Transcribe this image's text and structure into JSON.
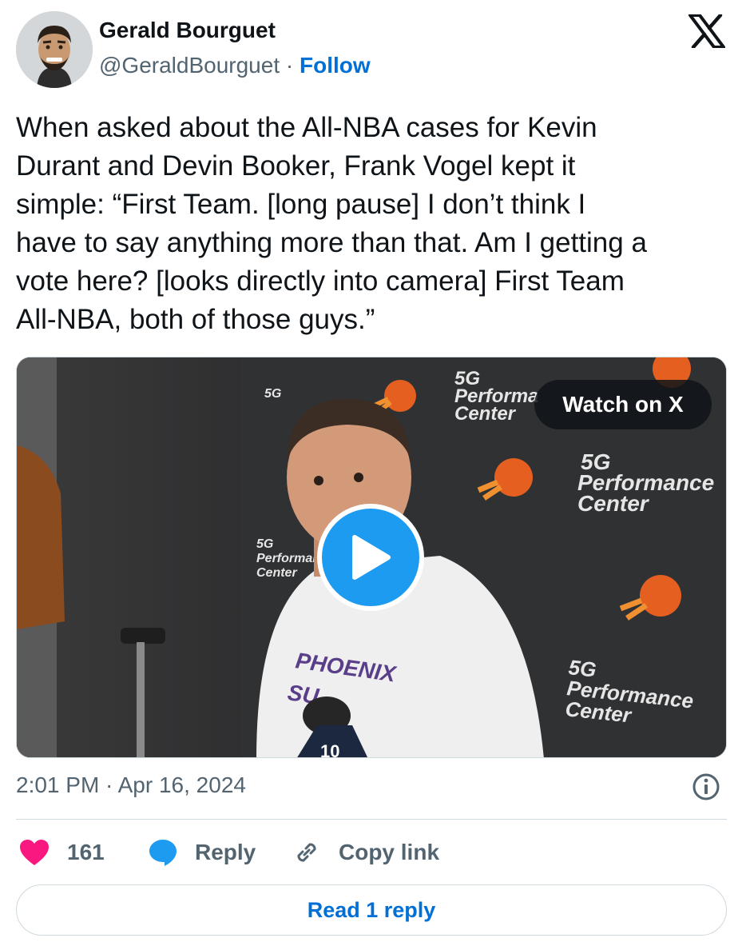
{
  "author": {
    "name": "Gerald Bourguet",
    "handle": "@GeraldBourguet",
    "separator": "·",
    "follow_label": "Follow"
  },
  "tweet": {
    "text": "When asked about the All-NBA cases for Kevin\nDurant and Devin Booker, Frank Vogel kept it\nsimple: “First Team. [long pause] I don’t think I\nhave to say anything more than that. Am I getting a\nvote here? [looks directly into camera] First Team\nAll-NBA, both of those guys.”"
  },
  "media": {
    "watch_label": "Watch on X",
    "backdrop_text": [
      "5G",
      "Performance",
      "Center"
    ],
    "shirt_text": [
      "PHOENIX",
      "SU"
    ],
    "mic_text": "10"
  },
  "meta": {
    "timestamp": "2:01 PM · Apr 16, 2024"
  },
  "actions": {
    "like_count": "161",
    "reply_label": "Reply",
    "copy_label": "Copy link",
    "read_reply_label": "Read 1 reply"
  },
  "colors": {
    "like": "#f91880",
    "reply_bubble": "#1d9bf0",
    "link_blue": "#006fd6",
    "muted": "#536471"
  }
}
